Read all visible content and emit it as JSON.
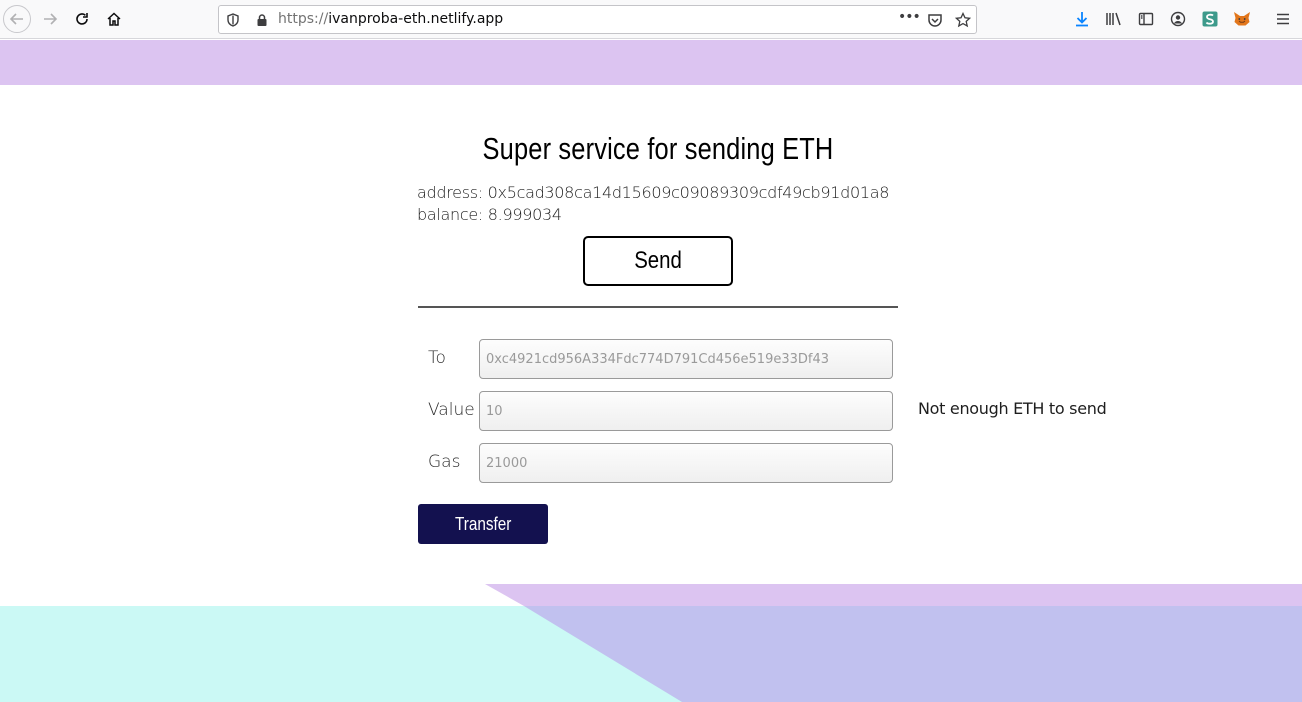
{
  "browser": {
    "url_scheme": "https://",
    "url_host": "ivanproba-eth.netlify.app",
    "page_actions_glyph": "•••"
  },
  "page": {
    "title": "Super service for sending ETH",
    "address_label": "address: ",
    "address_value": "0x5cad308ca14d15609c09089309cdf49cb91d01a8",
    "balance_label": "balance: ",
    "balance_value": "8.999034",
    "send_label": "Send"
  },
  "form": {
    "to_label": "To",
    "to_placeholder": "0xc4921cd956A334Fdc774D791Cd456e519e33Df43",
    "value_label": "Value",
    "value_placeholder": "10",
    "gas_label": "Gas",
    "gas_placeholder": "21000",
    "error_message": "Not enough ETH to send",
    "transfer_label": "Transfer"
  },
  "colors": {
    "top_band": "#dcc4f1",
    "transfer_button": "#13114f",
    "bottom_cyan": "#cbf9f5",
    "bottom_lavender": "#dcc4f1",
    "bottom_periwinkle": "#c1c1ef"
  }
}
